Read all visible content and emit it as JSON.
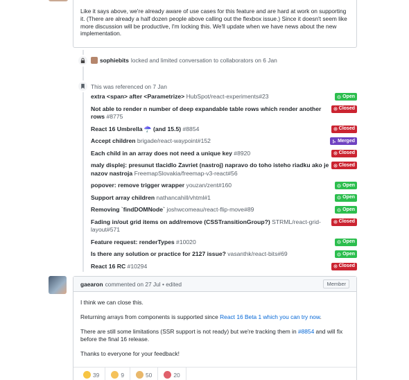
{
  "top_comment": {
    "text": "Like it says above, we're already aware of use cases for this feature and are hard at work on supporting it. (There are already a half dozen people above calling out the flexbox issue.) Since it doesn't seem like more discussion will be productive, I'm locking this. We'll update when we have news about the new implementation."
  },
  "lock_event": {
    "user": "sophiebits",
    "text": "locked and limited conversation to collaborators on 6 Jan"
  },
  "references": {
    "header": "This was referenced on 7 Jan",
    "items": [
      {
        "title": "extra <span> after <Parametrize>",
        "ref": "HubSpot/react-experiments#23",
        "state": "Open"
      },
      {
        "title": "Not able to render n number of deep expandable table rows which render another rows",
        "ref": "#8775",
        "state": "Closed"
      },
      {
        "title": "React 16 Umbrella ☂️ (and 15.5)",
        "ref": "#8854",
        "state": "Closed"
      },
      {
        "title": "Accept children",
        "ref": "brigade/react-waypoint#152",
        "state": "Merged"
      },
      {
        "title": "Each child in an array does not need a unique key",
        "ref": "#8920",
        "state": "Closed"
      },
      {
        "title": "maly displej: presunut tlacidlo Zavriet (nastroj) napravo do toho isteho riadku ako je nazov nastroja",
        "ref": "FreemapSlovakia/freemap-v3-react#56",
        "state": "Closed"
      },
      {
        "title": "popover: remove trigger wrapper",
        "ref": "youzan/zent#160",
        "state": "Open"
      },
      {
        "title": "Support array children",
        "ref": "nathancahill/vhtml#1",
        "state": "Open"
      },
      {
        "title": "Removing `findDOMNode`",
        "ref": "joshwcomeau/react-flip-move#89",
        "state": "Open"
      },
      {
        "title": "Fading in/out grid items on add/remove (CSSTransitionGroup?)",
        "ref": "STRML/react-grid-layout#571",
        "state": "Closed"
      },
      {
        "title": "Feature request: renderTypes",
        "ref": "#10020",
        "state": "Open"
      },
      {
        "title": "Is there any solution or practice for 2127 issue?",
        "ref": "vasanthk/react-bits#69",
        "state": "Open"
      },
      {
        "title": "React 16 RC",
        "ref": "#10294",
        "state": "Closed"
      }
    ]
  },
  "comment": {
    "author": "gaearon",
    "meta": "commented on 27 Jul • edited",
    "role": "Member",
    "p1": "I think we can close this.",
    "p2_pre": "Returning arrays from components is supported since ",
    "p2_link": "React 16 Beta 1 which you can try now",
    "p2_post": ".",
    "p3_pre": "There are still some limitations (SSR support is not ready) but we're tracking them in ",
    "p3_link": "#8854",
    "p3_post": " and will fix before the final 16 release.",
    "p4": "Thanks to everyone for your feedback!"
  },
  "reactions": [
    {
      "name": "thumbs-up",
      "count": "39",
      "color": "#f7c543"
    },
    {
      "name": "smile",
      "count": "9",
      "color": "#f5c25a"
    },
    {
      "name": "hooray",
      "count": "50",
      "color": "#e9b86b"
    },
    {
      "name": "heart",
      "count": "20",
      "color": "#e0606b"
    }
  ]
}
